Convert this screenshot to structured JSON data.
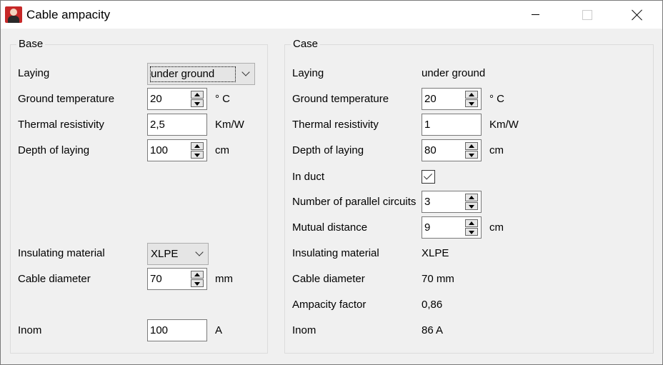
{
  "window": {
    "title": "Cable ampacity",
    "icon": "app-person-icon"
  },
  "base": {
    "title": "Base",
    "laying": {
      "label": "Laying",
      "value": "under ground"
    },
    "ground_temperature": {
      "label": "Ground temperature",
      "value": "20",
      "unit": "° C"
    },
    "thermal_resistivity": {
      "label": "Thermal resistivity",
      "value": "2,5",
      "unit": "Km/W"
    },
    "depth_of_laying": {
      "label": "Depth of laying",
      "value": "100",
      "unit": "cm"
    },
    "insulating_material": {
      "label": "Insulating material",
      "value": "XLPE"
    },
    "cable_diameter": {
      "label": "Cable diameter",
      "value": "70",
      "unit": "mm"
    },
    "inom": {
      "label": "Inom",
      "value": "100",
      "unit": "A"
    }
  },
  "case": {
    "title": "Case",
    "laying": {
      "label": "Laying",
      "value": "under ground"
    },
    "ground_temperature": {
      "label": "Ground temperature",
      "value": "20",
      "unit": "° C"
    },
    "thermal_resistivity": {
      "label": "Thermal resistivity",
      "value": "1",
      "unit": "Km/W"
    },
    "depth_of_laying": {
      "label": "Depth of laying",
      "value": "80",
      "unit": "cm"
    },
    "in_duct": {
      "label": "In duct",
      "checked": true
    },
    "parallel_circuits": {
      "label": "Number of parallel circuits",
      "value": "3"
    },
    "mutual_distance": {
      "label": "Mutual distance",
      "value": "9",
      "unit": "cm"
    },
    "insulating_material": {
      "label": "Insulating material",
      "value": "XLPE"
    },
    "cable_diameter": {
      "label": "Cable diameter",
      "value": "70 mm"
    },
    "ampacity_factor": {
      "label": "Ampacity factor",
      "value": "0,86"
    },
    "inom": {
      "label": "Inom",
      "value": "86 A"
    }
  }
}
